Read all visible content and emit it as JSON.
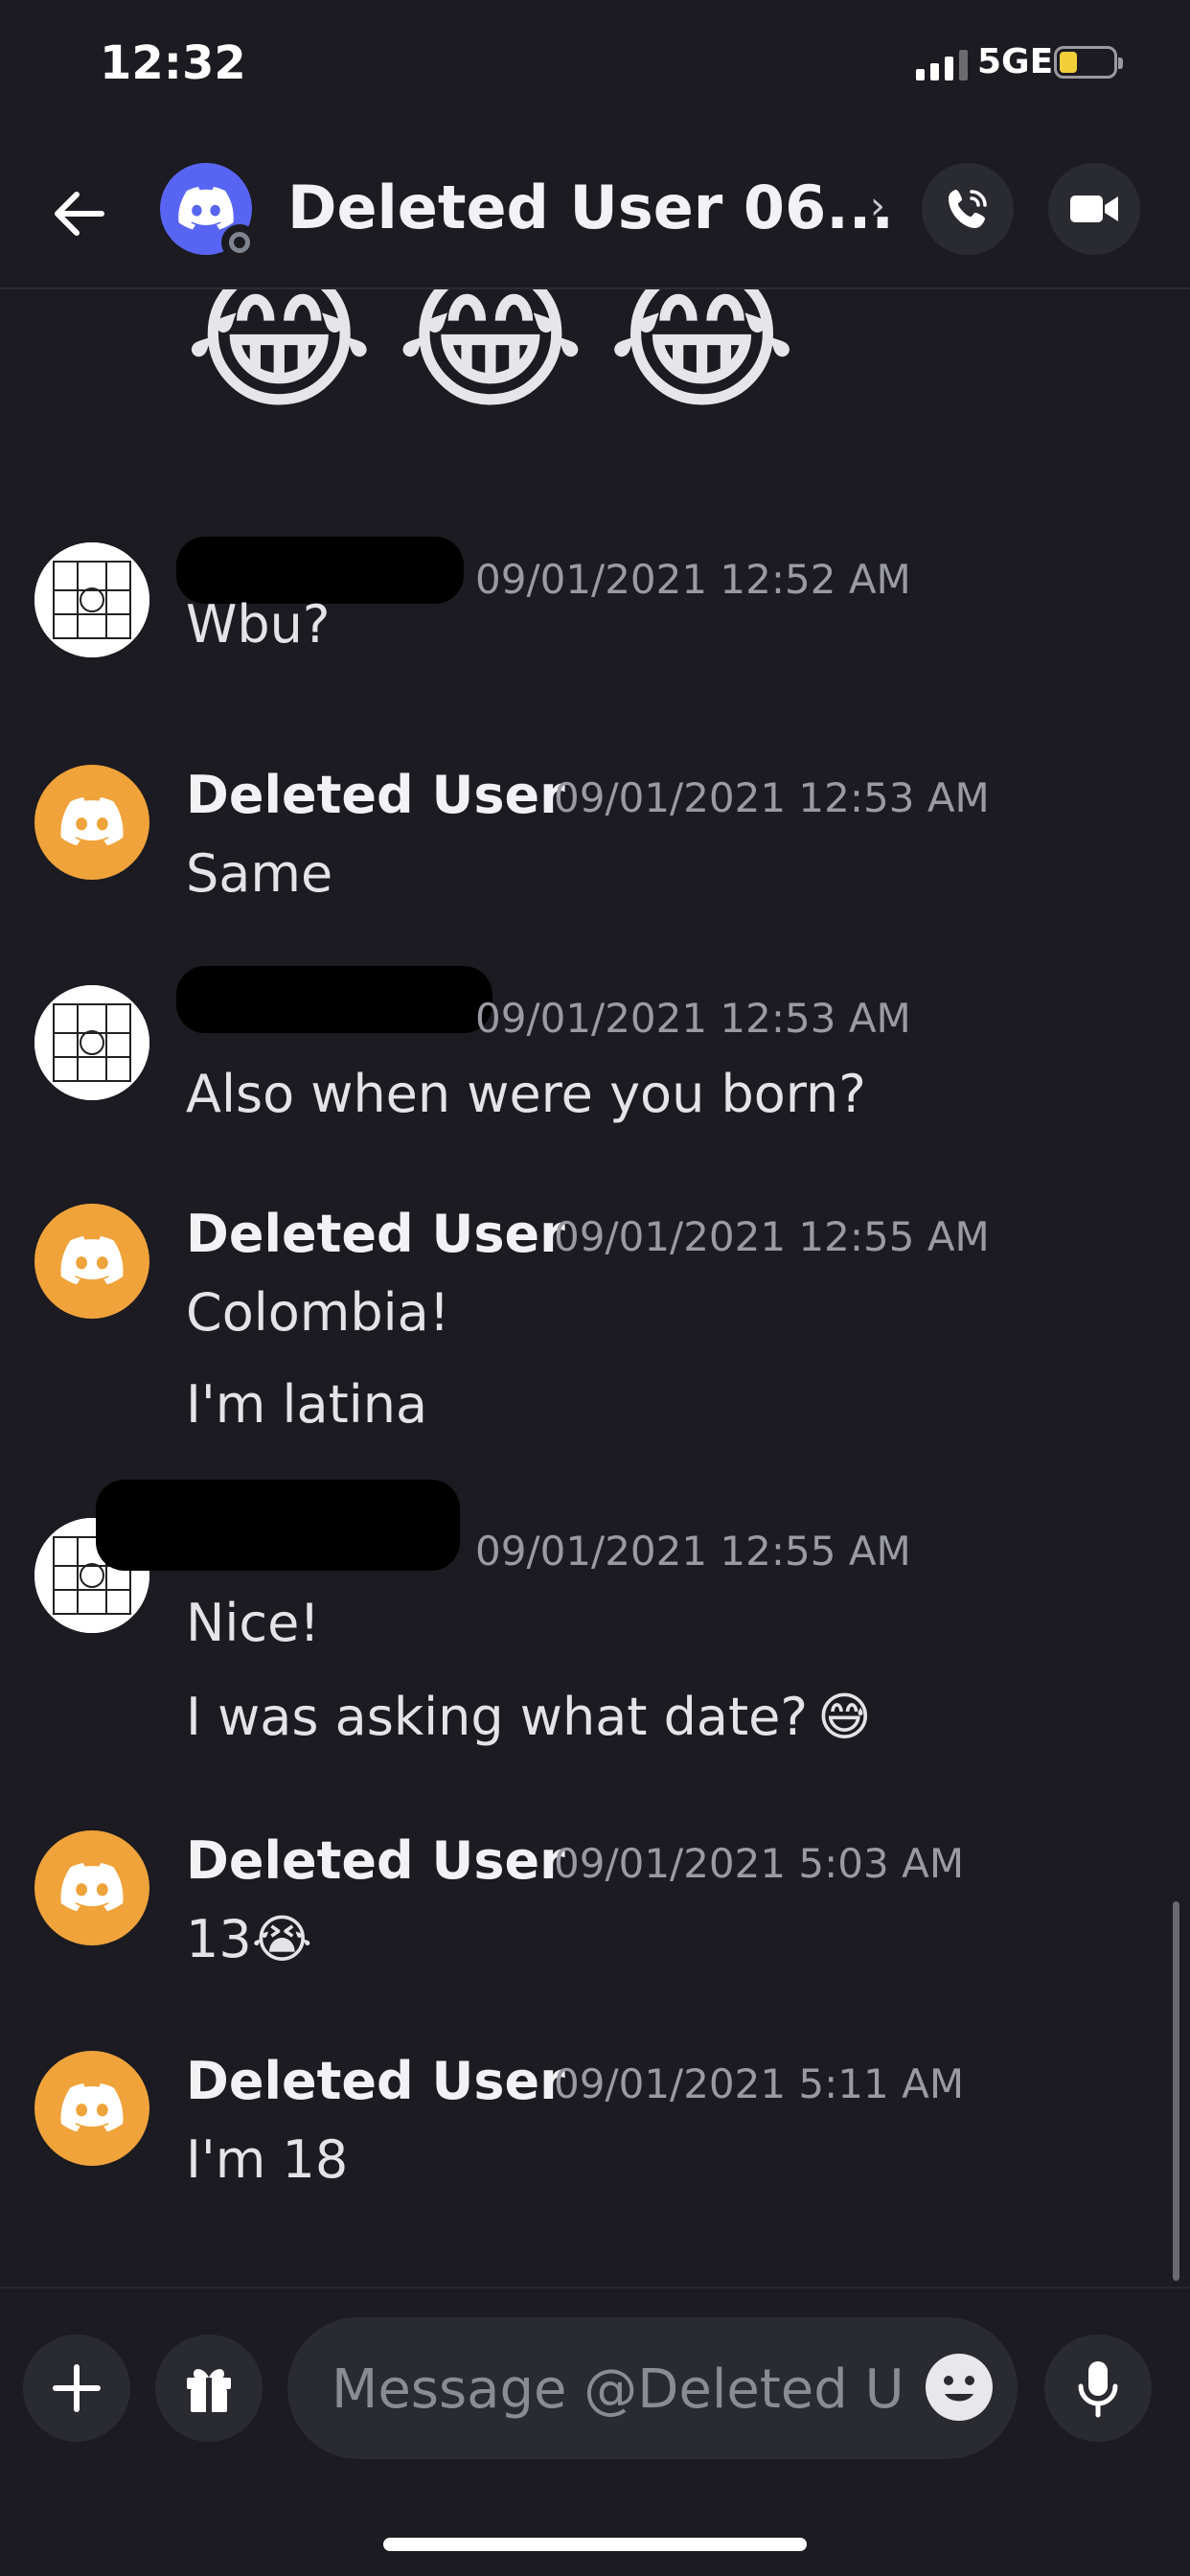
{
  "status_bar": {
    "time": "12:32",
    "network": "5GE",
    "battery_level": 0.25
  },
  "header": {
    "title": "Deleted User 06...",
    "chevron": "›",
    "call_icon": "phone-icon",
    "video_icon": "video-camera-icon"
  },
  "big_emojis": [
    "😂",
    "😂",
    "😂"
  ],
  "messages": [
    {
      "author": "",
      "timestamp": "09/01/2021 12:52 AM",
      "lines": [
        "Wbu?"
      ],
      "avatar": "photo"
    },
    {
      "author": "Deleted User",
      "timestamp": "09/01/2021 12:53 AM",
      "lines": [
        "Same"
      ],
      "avatar": "discord"
    },
    {
      "author": "",
      "timestamp": "09/01/2021 12:53 AM",
      "lines": [
        "Also when were you born?"
      ],
      "avatar": "photo"
    },
    {
      "author": "Deleted User",
      "timestamp": "09/01/2021 12:55 AM",
      "lines": [
        "Colombia!",
        "I'm latina"
      ],
      "avatar": "discord"
    },
    {
      "author": "",
      "timestamp": "09/01/2021 12:55 AM",
      "lines": [
        "Nice!",
        "I was asking what date?"
      ],
      "line_emoji": "😅",
      "avatar": "photo"
    },
    {
      "author": "Deleted User",
      "timestamp": "09/01/2021 5:03 AM",
      "lines": [
        "13"
      ],
      "line_emoji": "😭",
      "avatar": "discord"
    },
    {
      "author": "Deleted User",
      "timestamp": "09/01/2021 5:11 AM",
      "lines": [
        "I'm 18"
      ],
      "avatar": "discord"
    }
  ],
  "composer": {
    "placeholder": "Message @Deleted U..",
    "add_icon": "plus-icon",
    "gift_icon": "gift-icon",
    "emoji_icon": "smiley-icon",
    "mic_icon": "microphone-icon"
  }
}
